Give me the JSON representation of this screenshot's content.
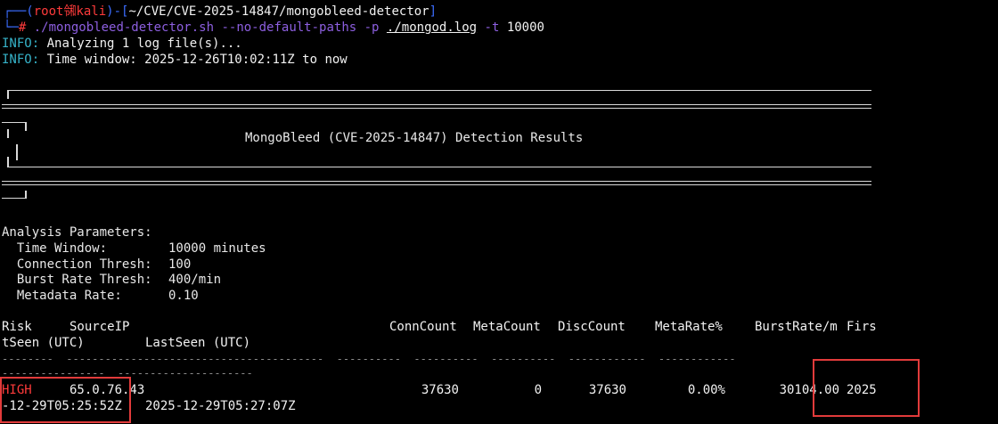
{
  "prompt": {
    "user": "root",
    "skull": "㋿",
    "host": "kali",
    "path": "~/CVE/CVE-2025-14847/mongobleed-detector",
    "hash": "#",
    "command": "./mongobleed-detector.sh",
    "arg1": "--no-default-paths",
    "arg2": "-p",
    "logfile": "./mongod.log",
    "arg3": "-t",
    "arg4": "10000"
  },
  "info_lines": [
    {
      "tag": "INFO:",
      "text": " Analyzing 1 log file(s)..."
    },
    {
      "tag": "INFO:",
      "text": " Time window: 2025-12-26T10:02:11Z to now"
    }
  ],
  "banner": {
    "title": "MongoBleed (CVE-2025-14847) Detection Results"
  },
  "params": {
    "heading": "Analysis Parameters:",
    "rows": [
      {
        "label": "  Time Window:",
        "value": "10000 minutes"
      },
      {
        "label": "  Connection Thresh:",
        "value": "100"
      },
      {
        "label": "  Burst Rate Thresh:",
        "value": "400/min"
      },
      {
        "label": "  Metadata Rate:",
        "value": "0.10"
      }
    ]
  },
  "table": {
    "headers": {
      "risk": "Risk",
      "source_ip": "SourceIP",
      "conn": "ConnCount",
      "meta": "MetaCount",
      "disc": "DiscCount",
      "metarate": "MetaRate%",
      "burst": "BurstRate/m",
      "first": "Firs",
      "first_wrap": "tSeen (UTC)",
      "last": "LastSeen (UTC)"
    },
    "row": {
      "risk": "HIGH",
      "ip": "65.0.76.43",
      "conn": "37630",
      "meta": "0",
      "disc": "37630",
      "metarate": "0.00%",
      "burst": "30104.00",
      "first_part": "2025",
      "first_wrap": "-12-29T05:25:52Z",
      "last": "2025-12-29T05:27:07Z"
    },
    "risk_color": "#ff3b3b"
  }
}
